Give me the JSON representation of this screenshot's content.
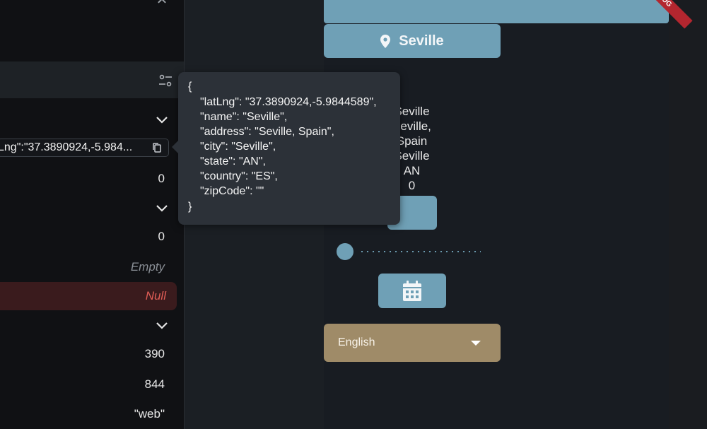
{
  "inspector": {
    "latlng_chip_text": "Lng\":\"37.3890924,-5.984...",
    "rows": [
      {
        "value": "0"
      },
      {
        "value": "0"
      },
      {
        "value": "Empty"
      },
      {
        "value": "Null"
      },
      {
        "value": "390"
      },
      {
        "value": "844"
      },
      {
        "value": "\"web\""
      }
    ]
  },
  "tooltip": {
    "lines": [
      "{",
      "\"latLng\": \"37.3890924,-5.9844589\",",
      "\"name\": \"Seville\",",
      "\"address\": \"Seville, Spain\",",
      "\"city\": \"Seville\",",
      "\"state\": \"AN\",",
      "\"country\": \"ES\",",
      "\"zipCode\": \"\"",
      "}"
    ]
  },
  "app": {
    "debug_banner": "DEBUG",
    "place_button_label": "Seville",
    "details": [
      "Seville",
      "Seville, Spain",
      "Seville",
      "AN",
      "0"
    ],
    "language_select_value": "English"
  },
  "colors": {
    "accent": "#6fa0b6",
    "select_bg": "#9f8b68",
    "null_text": "#e05d56",
    "tooltip_bg": "#2c3138"
  }
}
